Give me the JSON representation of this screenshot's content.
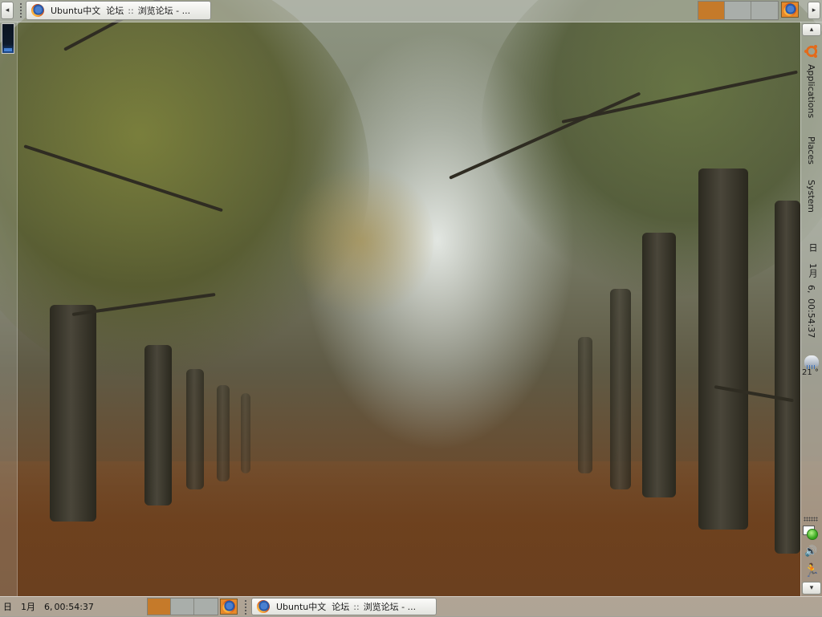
{
  "top_panel": {
    "task_button": {
      "app": "Ubuntu中文",
      "title_part1": "论坛",
      "separator": "::",
      "title_part2": "浏览论坛 - ..."
    },
    "workspaces": {
      "count": 3,
      "active": 1
    }
  },
  "bottom_panel": {
    "clock": {
      "weekday": "日",
      "month": "1月",
      "day": "6,",
      "time": "00:54:37"
    },
    "task_button": {
      "app": "Ubuntu中文",
      "title_part1": "论坛",
      "separator": "::",
      "title_part2": "浏览论坛 - ..."
    },
    "workspaces": {
      "count": 3,
      "active": 1
    }
  },
  "right_panel": {
    "menus": [
      "Applications",
      "Places",
      "System"
    ],
    "clock": {
      "weekday": "日",
      "month": "1月",
      "day": "6,",
      "time": "00:54:37"
    },
    "weather": {
      "temperature": "21 °"
    }
  },
  "icons": {
    "scroll_left": "◂",
    "scroll_right": "▸",
    "scroll_up": "▴",
    "scroll_down": "▾",
    "volume": "🔊",
    "run": "🏃"
  },
  "colors": {
    "workspace_active": "#c57a2a",
    "workspace_idle": "#a9aeaa",
    "accent_orange": "#e26b1c"
  }
}
